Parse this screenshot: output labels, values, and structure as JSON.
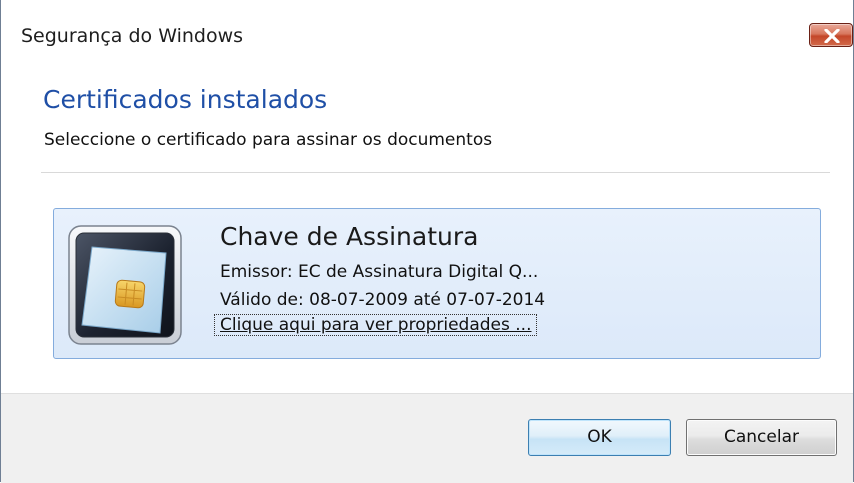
{
  "window": {
    "title": "Segurança do Windows",
    "close_icon": "close-icon"
  },
  "dialog": {
    "heading": "Certificados instalados",
    "subheading": "Seleccione o certificado para assinar os documentos"
  },
  "certificate": {
    "icon": "smart-card-icon",
    "name": "Chave de Assinatura",
    "issuer": "Emissor: EC de Assinatura Digital Q...",
    "validity": "Válido de: 08-07-2009 até 07-07-2014",
    "properties_link": "Clique aqui para ver propriedades ..."
  },
  "buttons": {
    "ok_label": "OK",
    "cancel_label": "Cancelar"
  },
  "colors": {
    "heading": "#1f4fa6",
    "card_border": "#84acdd",
    "close_button": "#c4472a"
  }
}
